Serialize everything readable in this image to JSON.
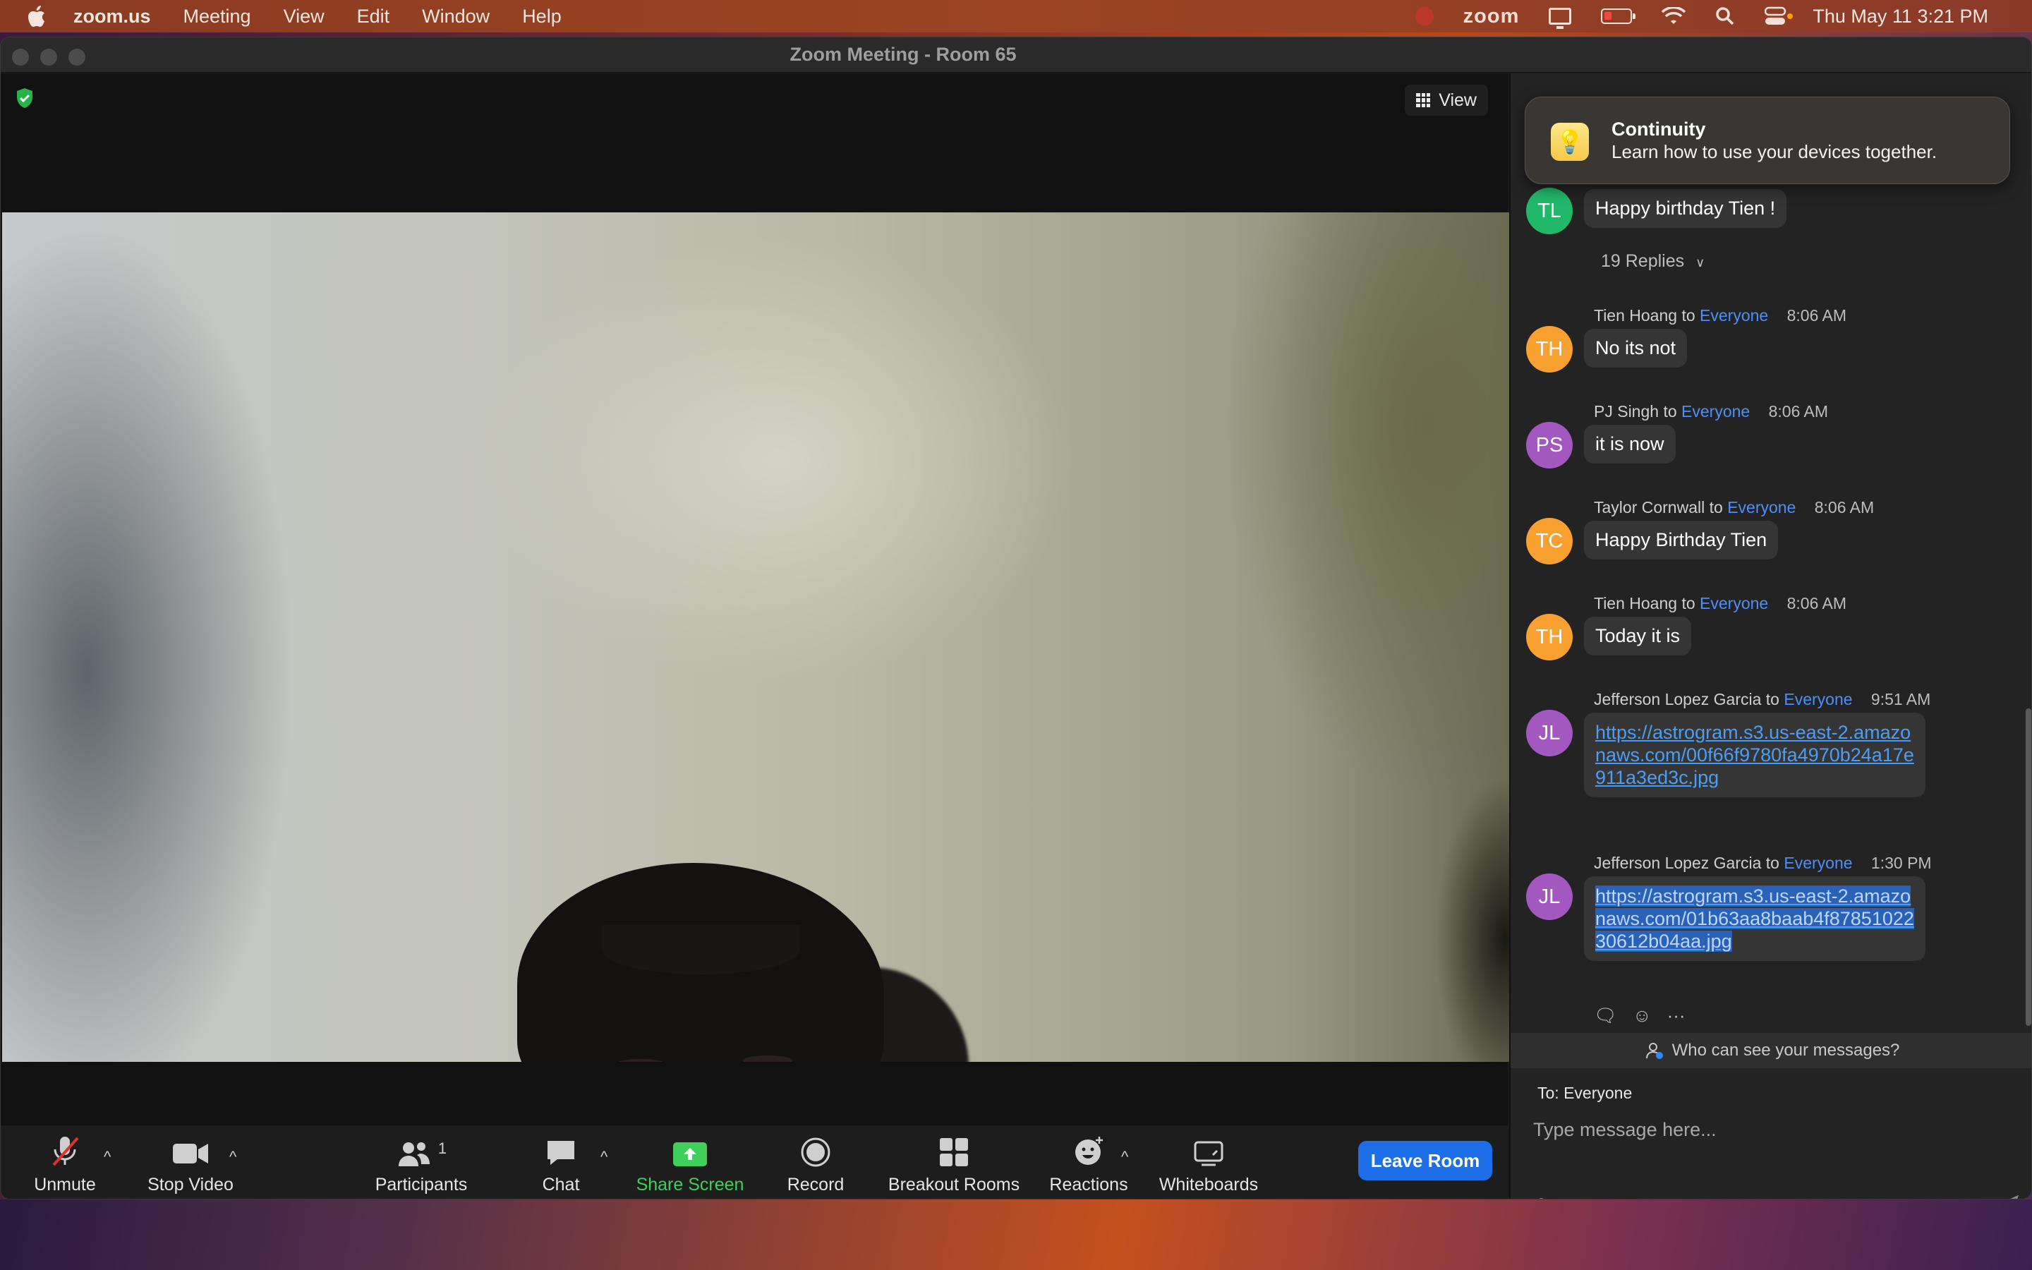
{
  "menubar": {
    "app_name": "zoom.us",
    "items": [
      "Meeting",
      "View",
      "Edit",
      "Window",
      "Help"
    ],
    "status_zoom": "zoom",
    "clock": "Thu May 11  3:21 PM"
  },
  "window": {
    "title": "Zoom Meeting - Room 65"
  },
  "video": {
    "view_label": "View"
  },
  "toolbar": {
    "unmute": "Unmute",
    "stop_video": "Stop Video",
    "participants": "Participants",
    "participants_count": "1",
    "chat": "Chat",
    "share_screen": "Share Screen",
    "record": "Record",
    "breakout_rooms": "Breakout Rooms",
    "reactions": "Reactions",
    "whiteboards": "Whiteboards",
    "leave_room": "Leave Room"
  },
  "notification": {
    "title": "Continuity",
    "body": "Learn how to use your devices together."
  },
  "chat": {
    "messages": [
      {
        "initials": "TL",
        "text": "Happy birthday Tien !",
        "replies": "19 Replies"
      },
      {
        "initials": "TH",
        "sender": "Tien Hoang",
        "to": "to",
        "recipient": "Everyone",
        "time": "8:06 AM",
        "text": "No its not"
      },
      {
        "initials": "PS",
        "sender": "PJ Singh",
        "to": "to",
        "recipient": "Everyone",
        "time": "8:06 AM",
        "text": "it is now"
      },
      {
        "initials": "TC",
        "sender": "Taylor Cornwall",
        "to": "to",
        "recipient": "Everyone",
        "time": "8:06 AM",
        "text": "Happy Birthday Tien"
      },
      {
        "initials": "TH",
        "sender": "Tien Hoang",
        "to": "to",
        "recipient": "Everyone",
        "time": "8:06 AM",
        "text": "Today it is"
      },
      {
        "initials": "JL",
        "sender": "Jefferson Lopez Garcia",
        "to": "to",
        "recipient": "Everyone",
        "time": "9:51 AM",
        "text": "https://astrogram.s3.us-east-2.amazonaws.com/00f66f9780fa4970b24a17e911a3ed3c.jpg"
      },
      {
        "initials": "JL",
        "sender": "Jefferson Lopez Garcia",
        "to": "to",
        "recipient": "Everyone",
        "time": "1:30 PM",
        "text": "https://astrogram.s3.us-east-2.amazonaws.com/01b63aa8baab4f8785102230612b04aa.jpg"
      }
    ],
    "who_can_see": "Who can see your messages?",
    "compose_to": "To: Everyone",
    "compose_placeholder": "Type message here..."
  },
  "colors": {
    "accent_blue": "#1e6ee8",
    "share_green": "#3fcf5a",
    "link_blue": "#4d9df5"
  }
}
